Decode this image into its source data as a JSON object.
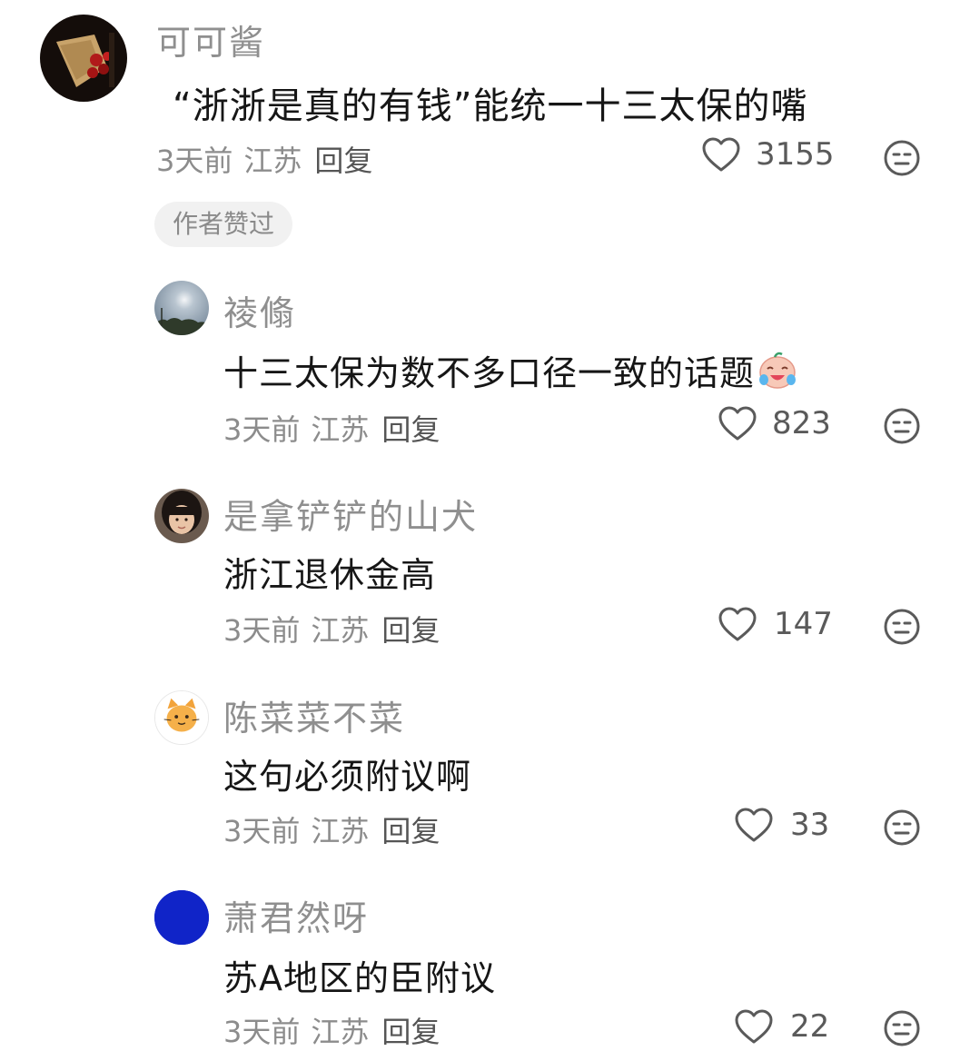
{
  "top_comment": {
    "avatar": "bouquet-avatar",
    "username": "可可酱",
    "text": "“浙浙是真的有钱”能统一十三太保的嘴",
    "time": "3天前",
    "location": "江苏",
    "reply_label": "回复",
    "likes": "3155",
    "badge": "作者赞过"
  },
  "replies": [
    {
      "avatar": "sky-avatar",
      "username": "祾翛",
      "text": "十三太保为数不多口径一致的话题",
      "emoji": "crying-laugh-emoji",
      "time": "3天前",
      "location": "江苏",
      "reply_label": "回复",
      "likes": "823"
    },
    {
      "avatar": "girl-photo-avatar",
      "username": "是拿铲铲的山犬",
      "text": "浙江退休金高",
      "time": "3天前",
      "location": "江苏",
      "reply_label": "回复",
      "likes": "147"
    },
    {
      "avatar": "cat-emoji-avatar",
      "username": "陈菜菜不菜",
      "text": "这句必须附议啊",
      "time": "3天前",
      "location": "江苏",
      "reply_label": "回复",
      "likes": "33"
    },
    {
      "avatar": "blue-circle-avatar",
      "username": "萧君然呀",
      "text": "苏A地区的臣附议",
      "time": "3天前",
      "location": "江苏",
      "reply_label": "回复",
      "likes": "22"
    }
  ],
  "icons": {
    "like": "heart-outline-icon",
    "dislike": "meh-face-icon"
  },
  "colors": {
    "username": "#8f8f8f",
    "meta": "#8c8c8c",
    "badge_bg": "#f1f1f1",
    "blue_avatar": "#1024c8"
  }
}
